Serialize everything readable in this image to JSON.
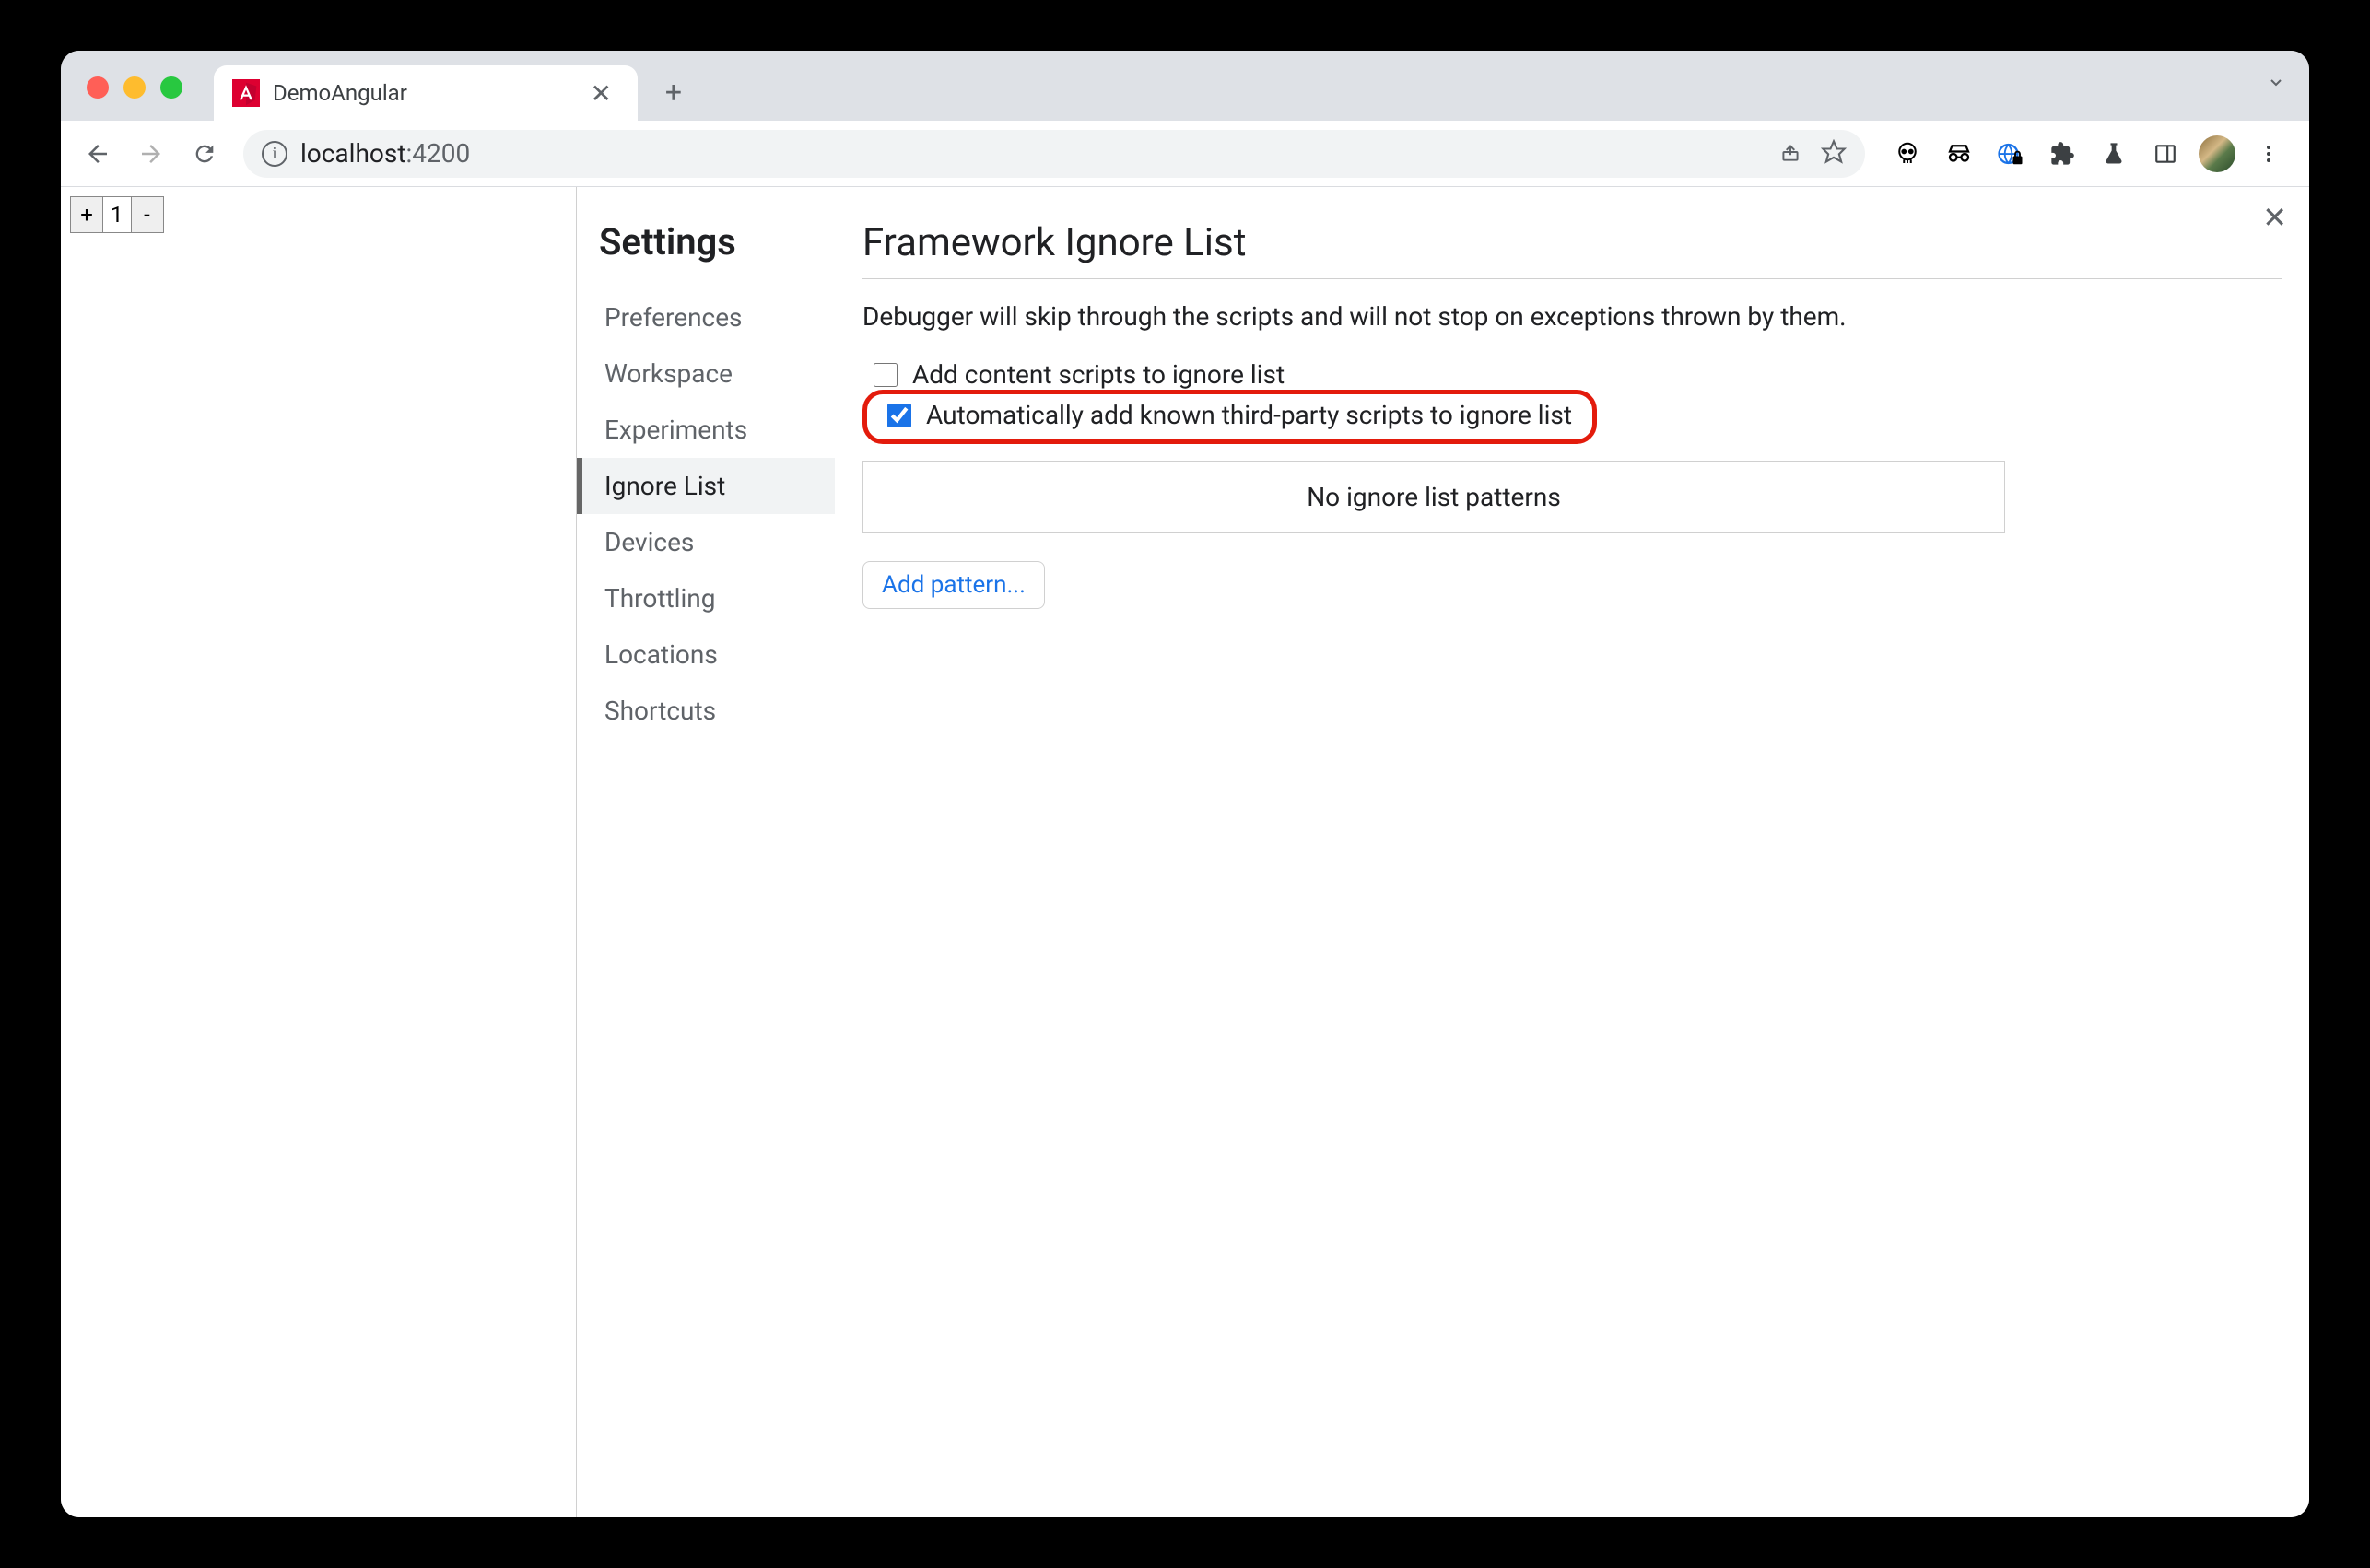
{
  "browser": {
    "tab_title": "DemoAngular",
    "url_host": "localhost",
    "url_port": ":4200"
  },
  "page": {
    "counter_value": "1",
    "plus": "+",
    "minus": "-"
  },
  "devtools": {
    "title": "Settings",
    "nav": {
      "preferences": "Preferences",
      "workspace": "Workspace",
      "experiments": "Experiments",
      "ignore_list": "Ignore List",
      "devices": "Devices",
      "throttling": "Throttling",
      "locations": "Locations",
      "shortcuts": "Shortcuts"
    },
    "panel": {
      "heading": "Framework Ignore List",
      "description": "Debugger will skip through the scripts and will not stop on exceptions thrown by them.",
      "checkbox_content_scripts": "Add content scripts to ignore list",
      "checkbox_content_scripts_checked": false,
      "checkbox_third_party": "Automatically add known third-party scripts to ignore list",
      "checkbox_third_party_checked": true,
      "no_patterns": "No ignore list patterns",
      "add_pattern": "Add pattern..."
    }
  }
}
